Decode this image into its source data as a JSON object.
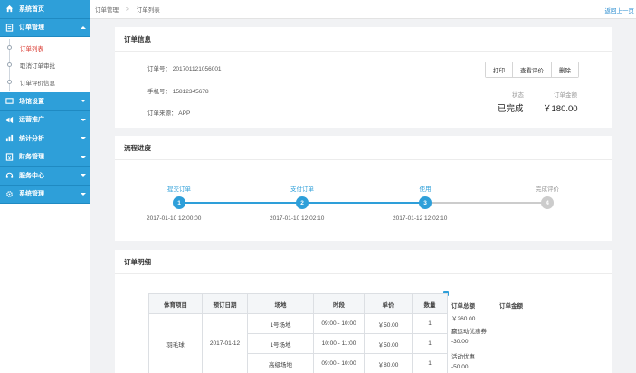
{
  "sidebar": {
    "home": "系统首页",
    "order_mgmt": "订单管理",
    "sub_items": [
      "订单列表",
      "取消订单审批",
      "订单评价信息"
    ],
    "venue": "场馆设置",
    "marketing": "运营推广",
    "stats": "统计分析",
    "finance": "财务管理",
    "service": "服务中心",
    "system": "系统管理"
  },
  "topbar": {
    "crumb1": "订单管理",
    "sep": ">",
    "crumb2": "订单列表",
    "back": "返回上一页"
  },
  "order_info": {
    "title": "订单信息",
    "order_no": "订单号：  201701121056001",
    "phone": "手机号：  15812345678",
    "source": "订单来源：  APP",
    "buttons": [
      "打印",
      "查看评价",
      "删除"
    ],
    "status_label": "状态",
    "status_value": "已完成",
    "amount_label": "订单金额",
    "amount_value": "￥180.00"
  },
  "progress": {
    "title": "流程进度",
    "steps": [
      {
        "label": "提交订单",
        "num": "1",
        "time": "2017-01-10  12:00:00",
        "done": true
      },
      {
        "label": "支付订单",
        "num": "2",
        "time": "2017-01-10  12:02:10",
        "done": true
      },
      {
        "label": "使用",
        "num": "3",
        "time": "2017-01-12  12:02:10",
        "done": true
      },
      {
        "label": "完成评价",
        "num": "4",
        "time": "",
        "done": false
      }
    ]
  },
  "detail": {
    "title": "订单明细",
    "headers": [
      "体育项目",
      "预订日期",
      "场地",
      "时段",
      "单价",
      "数量"
    ],
    "sport": "羽毛球",
    "date": "2017-01-12",
    "rows": [
      {
        "venue": "1号场地",
        "time": "09:00 - 10:00",
        "price": "￥50.00",
        "qty": "1"
      },
      {
        "venue": "1号场地",
        "time": "10:00 - 11:00",
        "price": "￥50.00",
        "qty": "1"
      },
      {
        "venue": "高级场地",
        "time": "09:00 - 10:00",
        "price": "￥80.00",
        "qty": "1"
      }
    ],
    "summary_header1": "订单总额",
    "summary_header2": "订单金额",
    "summary": [
      "￥260.00",
      "赢运动优惠券",
      "-30.00",
      "活动优惠",
      "-50.00"
    ]
  },
  "colors": {
    "accent": "#2e9fd9",
    "active_sub": "#d9342b"
  }
}
